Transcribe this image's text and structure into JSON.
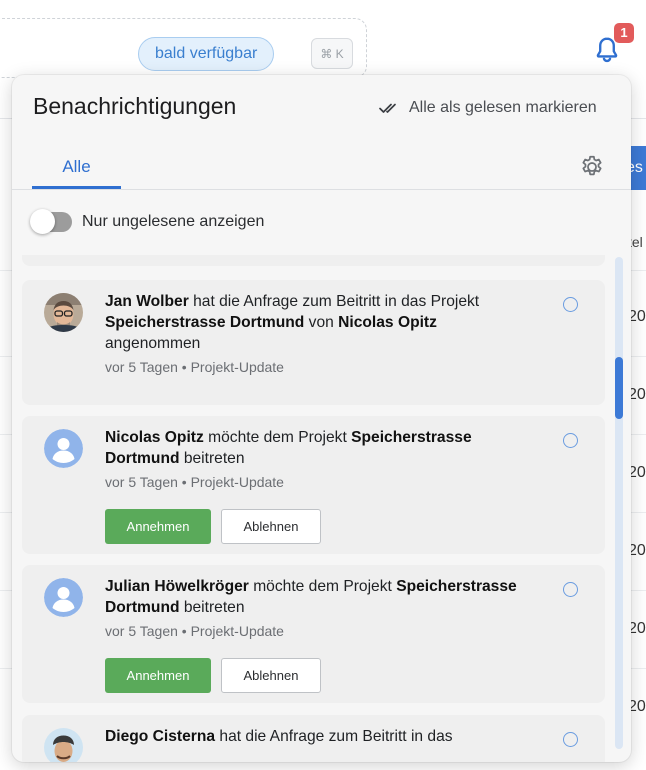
{
  "background": {
    "search_badge": "bald verfügbar",
    "search_shortcut": "⌘ K",
    "notification_count": "1",
    "partial_button": "es",
    "partial_column_header": "tel",
    "partial_cells": [
      "20",
      "20",
      "20",
      "20",
      "20",
      "20"
    ]
  },
  "panel": {
    "title": "Benachrichtigungen",
    "mark_all_read": "Alle als gelesen markieren",
    "tabs": [
      {
        "label": "Alle",
        "active": true
      }
    ],
    "toggle_label": "Nur ungelesene anzeigen",
    "toggle_on": false
  },
  "notifications": [
    {
      "actor": "Jan Wolber",
      "t1": " hat die Anfrage zum Beitritt in das Projekt ",
      "project": "Speicherstrasse Dortmund",
      "t2": " von ",
      "actor2": "Nicolas Opitz",
      "t3": " angenommen",
      "time": "vor 5 Tagen",
      "sep": "•",
      "category": "Projekt-Update",
      "avatar": "photo-man-glasses"
    },
    {
      "actor": "Nicolas Opitz",
      "t1": " möchte dem Projekt ",
      "project": "Speicherstrasse Dortmund",
      "t2": " beitreten",
      "time": "vor 5 Tagen",
      "sep": "•",
      "category": "Projekt-Update",
      "accept": "Annehmen",
      "decline": "Ablehnen",
      "avatar": "default-user-icon"
    },
    {
      "actor": "Julian Höwelkröger",
      "t1": " möchte dem Projekt ",
      "project": "Speicherstrasse Dortmund",
      "t2": " beitreten",
      "time": "vor 5 Tagen",
      "sep": "•",
      "category": "Projekt-Update",
      "accept": "Annehmen",
      "decline": "Ablehnen",
      "avatar": "default-user-icon"
    },
    {
      "actor": "Diego Cisterna",
      "t1": " hat die Anfrage zum Beitritt in das",
      "avatar": "photo-man-cap"
    }
  ],
  "colors": {
    "accent_blue": "#2f6fd0",
    "accept_green": "#5aaa5a",
    "badge_red": "#e25b5b"
  }
}
